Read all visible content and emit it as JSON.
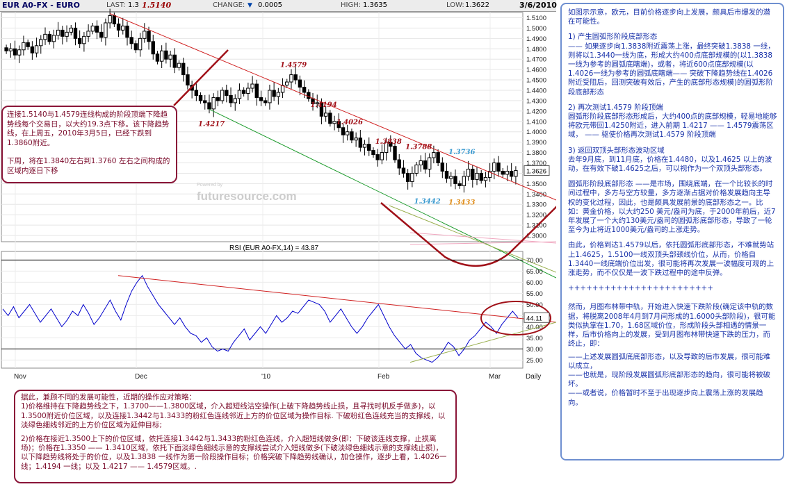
{
  "header": {
    "symbol": "EUR A0-FX - EURO",
    "last_label": "LAST:",
    "last_value": "1.3",
    "last_value_overlay": "1.5140",
    "change_label": "CHANGE:",
    "change_arrow": "▼",
    "change_value": "0.0005",
    "high_label": "HIGH:",
    "high_value": "1.3635",
    "low_label": "LOW:",
    "low_value": "1.3622",
    "date": "3/6/2010"
  },
  "colors": {
    "candle": "#000000",
    "resistance_line": "#d02020",
    "support_line_green": "#1a9a2a",
    "support_line_olive": "#9ab050",
    "rsi_line": "#0000cc",
    "annotation_red": "#a01018",
    "annotation_box_border": "#8a1538",
    "panel_border": "#6e8fd0",
    "panel_text": "#1a33aa"
  },
  "chart_data": [
    {
      "type": "candlestick",
      "title": "EUR A0-FX - EURO",
      "xlabel": "",
      "ylabel": "",
      "x_ticks": [
        "Nov",
        "Dec",
        "'10",
        "Feb",
        "Mar",
        "Daily"
      ],
      "ylim": [
        1.3,
        1.52
      ],
      "y_ticks": [
        1.3,
        1.31,
        1.32,
        1.33,
        1.34,
        1.35,
        1.36,
        1.37,
        1.38,
        1.39,
        1.4,
        1.41,
        1.42,
        1.43,
        1.44,
        1.45,
        1.46,
        1.47,
        1.48,
        1.49,
        1.5,
        1.51
      ],
      "y_tick_labels": [
        "1.3000",
        "1.3100",
        "1.3200",
        "1.3300",
        "1.3400",
        "1.3500",
        "1.3600",
        "1.3700",
        "1.3800",
        "1.3900",
        "1.4000",
        "1.4100",
        "1.4200",
        "1.4300",
        "1.4400",
        "1.4500",
        "1.4600",
        "1.4700",
        "1.4800",
        "1.4900",
        "1.5000",
        "1.5100"
      ],
      "last_price_label": "1.3626",
      "closes": [
        1.478,
        1.48,
        1.474,
        1.479,
        1.486,
        1.482,
        1.476,
        1.483,
        1.489,
        1.494,
        1.487,
        1.493,
        1.498,
        1.492,
        1.496,
        1.5,
        1.49,
        1.485,
        1.492,
        1.497,
        1.502,
        1.496,
        1.491,
        1.505,
        1.512,
        1.504,
        1.498,
        1.502,
        1.491,
        1.485,
        1.479,
        1.49,
        1.497,
        1.487,
        1.475,
        1.468,
        1.478,
        1.47,
        1.474,
        1.462,
        1.466,
        1.455,
        1.445,
        1.44,
        1.435,
        1.43,
        1.428,
        1.422,
        1.433,
        1.43,
        1.44,
        1.435,
        1.428,
        1.432,
        1.44,
        1.437,
        1.442,
        1.446,
        1.433,
        1.43,
        1.428,
        1.44,
        1.434,
        1.438,
        1.445,
        1.448,
        1.455,
        1.45,
        1.443,
        1.438,
        1.432,
        1.427,
        1.428,
        1.415,
        1.418,
        1.408,
        1.41,
        1.404,
        1.397,
        1.4,
        1.392,
        1.394,
        1.385,
        1.388,
        1.382,
        1.378,
        1.373,
        1.38,
        1.39,
        1.386,
        1.373,
        1.365,
        1.36,
        1.352,
        1.36,
        1.368,
        1.372,
        1.364,
        1.375,
        1.38,
        1.37,
        1.362,
        1.355,
        1.357,
        1.35,
        1.348,
        1.357,
        1.364,
        1.354,
        1.36,
        1.353,
        1.356,
        1.362,
        1.37,
        1.362,
        1.359,
        1.362,
        1.357,
        1.3626
      ],
      "annotations": [
        {
          "text": "1.4579",
          "x_index": 66,
          "y": 1.4579
        },
        {
          "text": "1.4217",
          "x_index": 47,
          "y": 1.4217
        },
        {
          "text": "1.4194",
          "x_index": 73,
          "y": 1.4194
        },
        {
          "text": "1.4026",
          "x_index": 79,
          "y": 1.4026
        },
        {
          "text": "1.3838",
          "x_index": 88,
          "y": 1.3838
        },
        {
          "text": "1.3788",
          "x_index": 95,
          "y": 1.3788
        },
        {
          "text": "1.3736",
          "x_index": 105,
          "y": 1.3736
        },
        {
          "text": "1.3442",
          "x_index": 97,
          "y": 1.3442
        },
        {
          "text": "1.3433",
          "x_index": 105,
          "y": 1.3433
        }
      ],
      "watermark": "futuresource.com",
      "watermark_sub": "Powered by"
    },
    {
      "type": "line",
      "title": "RSI (EUR A0-FX,14) = 43.87",
      "ylim": [
        20,
        75
      ],
      "y_ticks": [
        25,
        30,
        35,
        40,
        45,
        50,
        55,
        60,
        65,
        70
      ],
      "y_tick_labels": [
        "25.00",
        "30.00",
        "35.00",
        "40.00",
        "45.00",
        "50.00",
        "55.00",
        "60.00",
        "65.00",
        "70.00"
      ],
      "current_value_label": "44.11",
      "series": [
        {
          "values": [
            48,
            45,
            49,
            44,
            47,
            50,
            46,
            42,
            45,
            48,
            44,
            40,
            43,
            47,
            45,
            50,
            46,
            41,
            44,
            48,
            52,
            47,
            43,
            50,
            56,
            60,
            63,
            58,
            54,
            50,
            47,
            44,
            41,
            44,
            40,
            37,
            36,
            33,
            35,
            31,
            29,
            30,
            29,
            33,
            36,
            39,
            34,
            37,
            40,
            37,
            41,
            45,
            42,
            44,
            47,
            46,
            49,
            52,
            51,
            50,
            47,
            42,
            45,
            48,
            44,
            40,
            37,
            40,
            44,
            47,
            50,
            45,
            40,
            36,
            33,
            30,
            32,
            28,
            26,
            25,
            24,
            26,
            29,
            33,
            31,
            27,
            30,
            34,
            36,
            39,
            42,
            40,
            37,
            41,
            44,
            47,
            44.1
          ]
        }
      ]
    }
  ],
  "left_note": {
    "line1": "连接1.5140与1.4579连线构成的阶段顶端下降趋势线每个交易日，以大约19.3点下移。该下降趋势线，在上周五，2010年3月5日，已经下跌到1.3860附近。",
    "line2": "下周，将在1.3840左右到1.3760 左右之间构成的区域内逐日下移"
  },
  "right_panel": {
    "p1": "如图示示意，欧元，目前价格逐步向上发展，颇具后市爆发的潜在可能性。",
    "p2_title": "1) 产生圆弧形阶段底部形态",
    "p2": "—— 如果逐步向1.3838附近震荡上涨，最终突破1.3838 一线，则将以1.3440一线为底，形成大约400点底部规模的(以1.3838一线为参考的圆弧底瞎端)，或者，将近600点底部规模(以1.4026一线为参考的圆弧底瞎端—— 突破下降趋势线在1.4026附近受阻后，回测突破有效后，产生的底部形态规模)的圆弧形阶段底部形态",
    "p3_title": "2) 再次测试1.4579 阶段顶端",
    "p3": "圆弧形阶段底部形态形成后，大约400点的底部规模，轻易地能够将欧元带回1.4250附近，进入前期 1.4217 —— 1.4579震荡区域， —— 驱使价格再次测试1.4579 阶段顶端",
    "p4_title": "3) 返回双顶头部形态波动区域",
    "p4": "去年9月底，到11月底，价格在1.4480，以及1.4625 以上的波动，在有效下破1.4625之后，可以视作为一个双顶头部形态。",
    "p5": "圆弧形阶段底部形态 ——是市场，围绕底端，在一个比较长的时间过程中，多方与空方较量，多方逐渐占据对价格发展趋向主导权的变化过程，因此，也是颇具发展前景的底部形态之一。比如：黄金价格，以大约250 美元/盎司为底，于2000年前后，近7年发展了一个大约130美元/盎司的圆弧形底部形态，导致了一轮至今为止将近1000美元/盎司的上涨走势。",
    "p6": "由此，价格到达1.4579以后，依托圆弧形底部形态，不难就势站上1.4625，1.5100一线双顶头部颈线价位，从而，价格自1.3440一线底端价位出发，很可能将再次发展一波幅度可观的上涨走势，而不仅仅是一波下跌过程中的途中反弹。",
    "sep": "++++++++++++++++++++++++",
    "p7": "然而，月图布林带中轨，开始进入快速下跌阶段(确定该中轨的数据，将脱离2008年4月到7月间形成的1.6000头部阶段)，很可能类似执掌在1.70，1.68区域价位，形成阶段头部相遇的情景一样，后市价格向上的发展，受到月图布林带快速下跌的压力，而终止，即：",
    "p8": "——上述发展圆弧底底部形态，以及导致的后市发展，很可能难以成立，",
    "p9": "——也就是，现阶段发展圆弧形底部形态的趋向，很可能将被破坏。",
    "p10": "——或者说，价格暂时不至于出现逐步向上震荡上涨的发展趋向。"
  },
  "bottom_note": {
    "p1": "据此，兼顾不同的发展可能性，近期的操作应对策略：",
    "p2": "1)价格维持在下降趋势线之下，1.3700——1.3800区域，介入超短线沽空操作(上破下降趋势线止损，且寻找时机反手做多)，以1.3500附近价位区域，以及连接1.3442与1.3433的粉红色连线邻近上方的价位区域为操作目标. 下破粉红色连线充当的支撑线，以淡绿色细线邻近的上方价位区域为延伸目标;",
    "p3": "2)价格在接近1.3500上下的价位区域，依托连接1.3442与1.3433的粉红色连线，介入超短线做多(即：下破该连线支撑，止损离场)；价格在1.3350 —— 1.3410区域，依托下面淡绿色细线示意的支撑线尝试介入短线做多(下破淡绿色细线示意的支撑线止损)，以下降趋势线将处于的价位，以及1.3838 一线作为第一阶段操作目标；价格突破下降趋势线确认，加仓操作，逐步上看，1.4026一线；1.4194 一线；以及 1.4217 —— 1.4579区域。."
  }
}
